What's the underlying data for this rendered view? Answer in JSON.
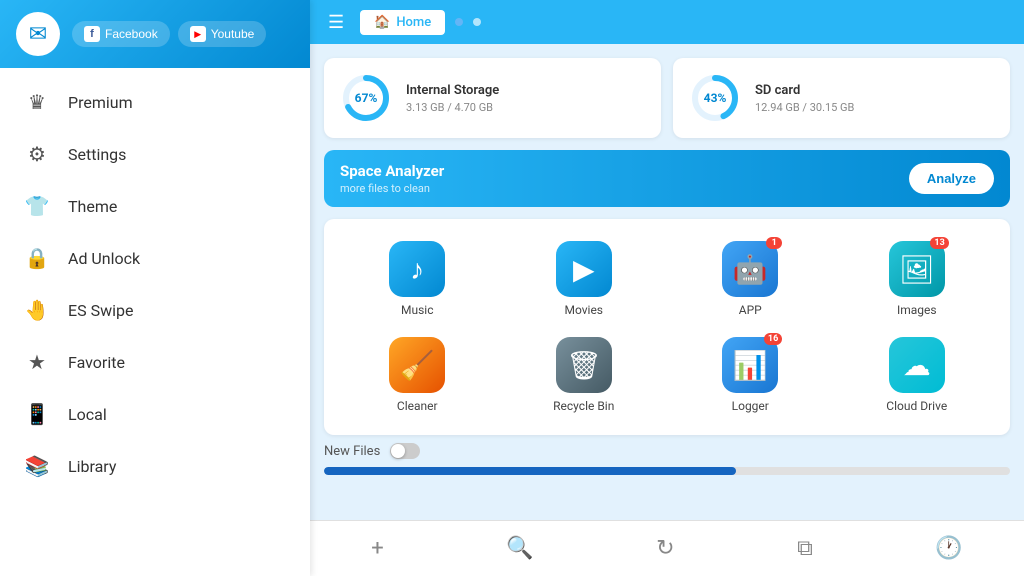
{
  "sidebar": {
    "avatar_icon": "✉",
    "social_buttons": [
      {
        "label": "Facebook",
        "icon": "f",
        "type": "fb"
      },
      {
        "label": "Youtube",
        "icon": "▶",
        "type": "yt"
      }
    ],
    "menu_items": [
      {
        "id": "premium",
        "icon": "♛",
        "label": "Premium"
      },
      {
        "id": "settings",
        "icon": "⚙",
        "label": "Settings"
      },
      {
        "id": "theme",
        "icon": "👕",
        "label": "Theme"
      },
      {
        "id": "ad-unlock",
        "icon": "🔒",
        "label": "Ad Unlock"
      },
      {
        "id": "es-swipe",
        "icon": "🤚",
        "label": "ES Swipe"
      },
      {
        "id": "favorite",
        "icon": "★",
        "label": "Favorite"
      },
      {
        "id": "local",
        "icon": "📱",
        "label": "Local"
      },
      {
        "id": "library",
        "icon": "📚",
        "label": "Library"
      }
    ]
  },
  "topbar": {
    "home_label": "Home",
    "tab_dots": 2
  },
  "storage": {
    "internal": {
      "label": "Internal Storage",
      "percent": 67,
      "used": "3.13 GB / 4.70 GB"
    },
    "sd": {
      "label": "SD card",
      "percent": 43,
      "used": "12.94 GB / 30.15 GB"
    }
  },
  "space_analyzer": {
    "title": "Space Analyzer",
    "subtitle": "more files to clean",
    "button_label": "Analyze"
  },
  "app_icons": [
    {
      "id": "music",
      "label": "Music",
      "icon": "♪",
      "color_class": "icon-music",
      "badge": null
    },
    {
      "id": "movies",
      "label": "Movies",
      "icon": "▶",
      "color_class": "icon-movies",
      "badge": null
    },
    {
      "id": "app",
      "label": "APP",
      "icon": "🤖",
      "color_class": "icon-app",
      "badge": "1"
    },
    {
      "id": "images",
      "label": "Images",
      "icon": "🖼",
      "color_class": "icon-images",
      "badge": "13"
    },
    {
      "id": "cleaner",
      "label": "Cleaner",
      "icon": "🧹",
      "color_class": "icon-cleaner",
      "badge": null
    },
    {
      "id": "recycle-bin",
      "label": "Recycle Bin",
      "icon": "🗑",
      "color_class": "icon-recycle",
      "badge": null
    },
    {
      "id": "logger",
      "label": "Logger",
      "icon": "📊",
      "color_class": "icon-logger",
      "badge": "16"
    },
    {
      "id": "cloud-drive",
      "label": "Cloud Drive",
      "icon": "☁",
      "color_class": "icon-cloud",
      "badge": null
    }
  ],
  "new_files": {
    "label": "New Files",
    "toggle": false,
    "progress_percent": 60
  },
  "bottom_nav": [
    {
      "id": "add",
      "icon": "+"
    },
    {
      "id": "search",
      "icon": "🔍"
    },
    {
      "id": "refresh",
      "icon": "↻"
    },
    {
      "id": "files",
      "icon": "⧉"
    },
    {
      "id": "history",
      "icon": "🕐"
    }
  ]
}
